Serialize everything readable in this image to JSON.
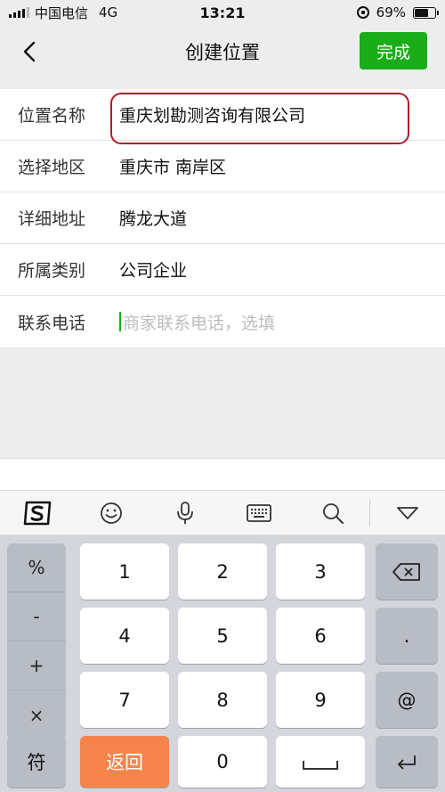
{
  "status_bar": {
    "carrier": "中国电信",
    "network": "4G",
    "time": "13:21",
    "battery": "69%",
    "battery_level": 0.69
  },
  "nav": {
    "title": "创建位置",
    "done_label": "完成"
  },
  "form": {
    "rows": [
      {
        "label": "位置名称",
        "value": "重庆划勘测咨询有限公司"
      },
      {
        "label": "选择地区",
        "value": "重庆市 南岸区"
      },
      {
        "label": "详细地址",
        "value": "腾龙大道"
      },
      {
        "label": "所属类别",
        "value": "公司企业"
      },
      {
        "label": "联系电话",
        "placeholder": "商家联系电话，选填"
      }
    ]
  },
  "keyboard": {
    "symbols": [
      "%",
      "-",
      "+",
      "×"
    ],
    "digits": [
      "1",
      "2",
      "3",
      "4",
      "5",
      "6",
      "7",
      "8",
      "9",
      "0"
    ],
    "dot": ".",
    "at": "@",
    "fu": "符",
    "back": "返回"
  },
  "icons": [
    "back-icon",
    "sogou-logo-icon",
    "emoji-icon",
    "microphone-icon",
    "keyboard-icon",
    "search-icon",
    "collapse-icon",
    "backspace-icon"
  ]
}
